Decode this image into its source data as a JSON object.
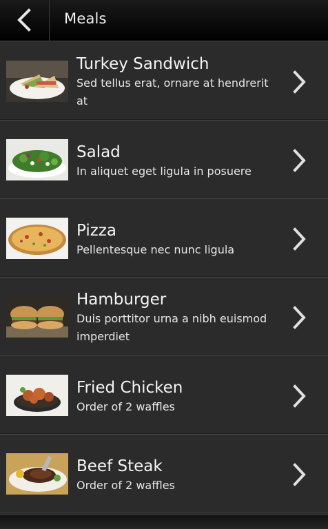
{
  "header": {
    "title": "Meals",
    "back_icon": "chevron-left-icon"
  },
  "meals": [
    {
      "title": "Turkey Sandwich",
      "description": "Sed tellus erat, ornare at hendrerit at",
      "image": "turkey-sandwich-photo"
    },
    {
      "title": "Salad",
      "description": "In aliquet eget ligula in posuere",
      "image": "salad-photo"
    },
    {
      "title": "Pizza",
      "description": "Pellentesque nec nunc ligula",
      "image": "pizza-photo"
    },
    {
      "title": "Hamburger",
      "description": "Duis porttitor urna a nibh euismod imperdiet",
      "image": "hamburger-photo"
    },
    {
      "title": "Fried Chicken",
      "description": "Order of 2 waffles",
      "image": "fried-chicken-photo"
    },
    {
      "title": "Beef Steak",
      "description": "Order of 2 waffles",
      "image": "beef-steak-photo"
    }
  ]
}
